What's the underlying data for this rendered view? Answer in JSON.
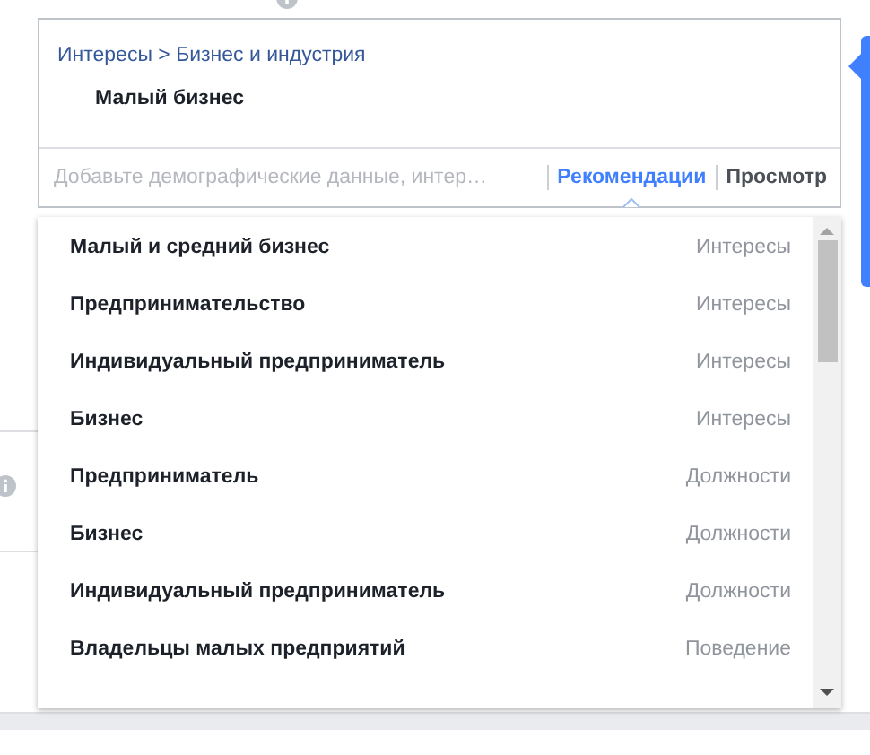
{
  "targeting": {
    "breadcrumb": "Интересы > Бизнес и индустрия",
    "selected_item": "Малый бизнес",
    "placeholder": "Добавьте демографические данные, интер…",
    "tabs": [
      {
        "label": "Рекомендации",
        "selected": true
      },
      {
        "label": "Просмотр",
        "selected": false
      }
    ]
  },
  "suggestions": [
    {
      "name": "Малый и средний бизнес",
      "category": "Интересы"
    },
    {
      "name": "Предпринимательство",
      "category": "Интересы"
    },
    {
      "name": "Индивидуальный предприниматель",
      "category": "Интересы"
    },
    {
      "name": "Бизнес",
      "category": "Интересы"
    },
    {
      "name": "Предприниматель",
      "category": "Должности"
    },
    {
      "name": "Бизнес",
      "category": "Должности"
    },
    {
      "name": "Индивидуальный предприниматель",
      "category": "Должности"
    },
    {
      "name": "Владельцы малых предприятий",
      "category": "Поведение"
    }
  ]
}
